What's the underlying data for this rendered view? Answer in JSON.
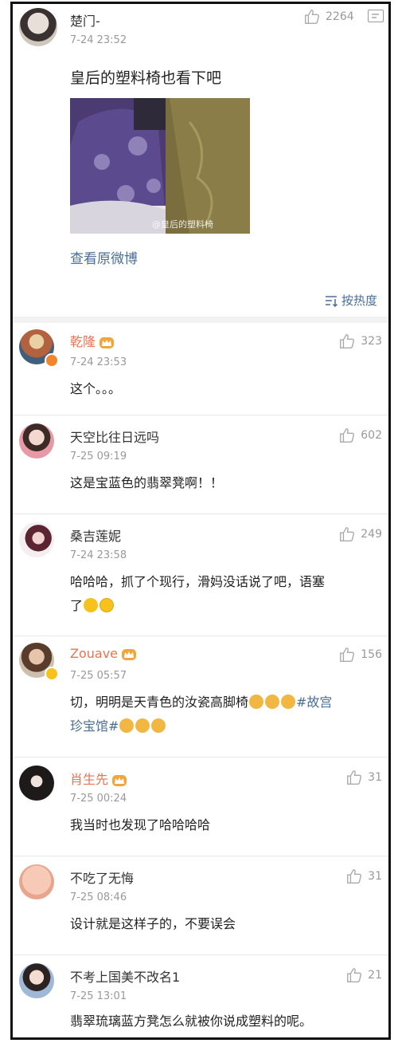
{
  "post": {
    "author": "楚门-",
    "time": "7-24 23:52",
    "likes": "2264",
    "text": "皇后的塑料椅也看下吧",
    "image_watermark": "@皇后的塑料椅",
    "view_original": "查看原微博",
    "sort_label": "按热度"
  },
  "comments": [
    {
      "name": "乾隆",
      "vip": true,
      "badge": "orange",
      "time": "7-24 23:53",
      "likes": "323",
      "text": "这个。。。"
    },
    {
      "name": "天空比往日远吗",
      "vip": false,
      "badge": "",
      "time": "7-25 09:19",
      "likes": "602",
      "text": "这是宝蓝色的翡翠凳啊！！"
    },
    {
      "name": "桑吉莲妮",
      "vip": false,
      "badge": "",
      "time": "7-24 23:58",
      "likes": "249",
      "text_line1": "哈哈哈，抓了个现行，滑妈没话说了吧，语塞",
      "text_line2": "了"
    },
    {
      "name": "Zouave",
      "vip": true,
      "badge": "yellow",
      "time": "7-25 05:57",
      "likes": "156",
      "text_part1": "切，明明是天青色的汝瓷高脚椅",
      "hashtag_part1": "#故宫",
      "hashtag_part2": "珍宝馆#"
    },
    {
      "name": "肖生先",
      "vip": true,
      "badge": "",
      "time": "7-25 00:24",
      "likes": "31",
      "text": "我当时也发现了哈哈哈哈"
    },
    {
      "name": "不吃了无悔",
      "vip": false,
      "badge": "",
      "time": "7-25 08:46",
      "likes": "31",
      "text": "设计就是这样子的，不要误会"
    },
    {
      "name": "不考上国美不改名1",
      "vip": false,
      "badge": "",
      "time": "7-25 13:01",
      "likes": "21",
      "text": "翡翠琉璃蓝方凳怎么就被你说成塑料的呢。"
    }
  ],
  "colors": {
    "vip_name": "#eb7350",
    "link": "#4a6f96",
    "meta": "#999999"
  },
  "icons": [
    "thumb-up-icon",
    "comment-icon",
    "crown-icon",
    "sort-icon",
    "emoji-icon"
  ]
}
